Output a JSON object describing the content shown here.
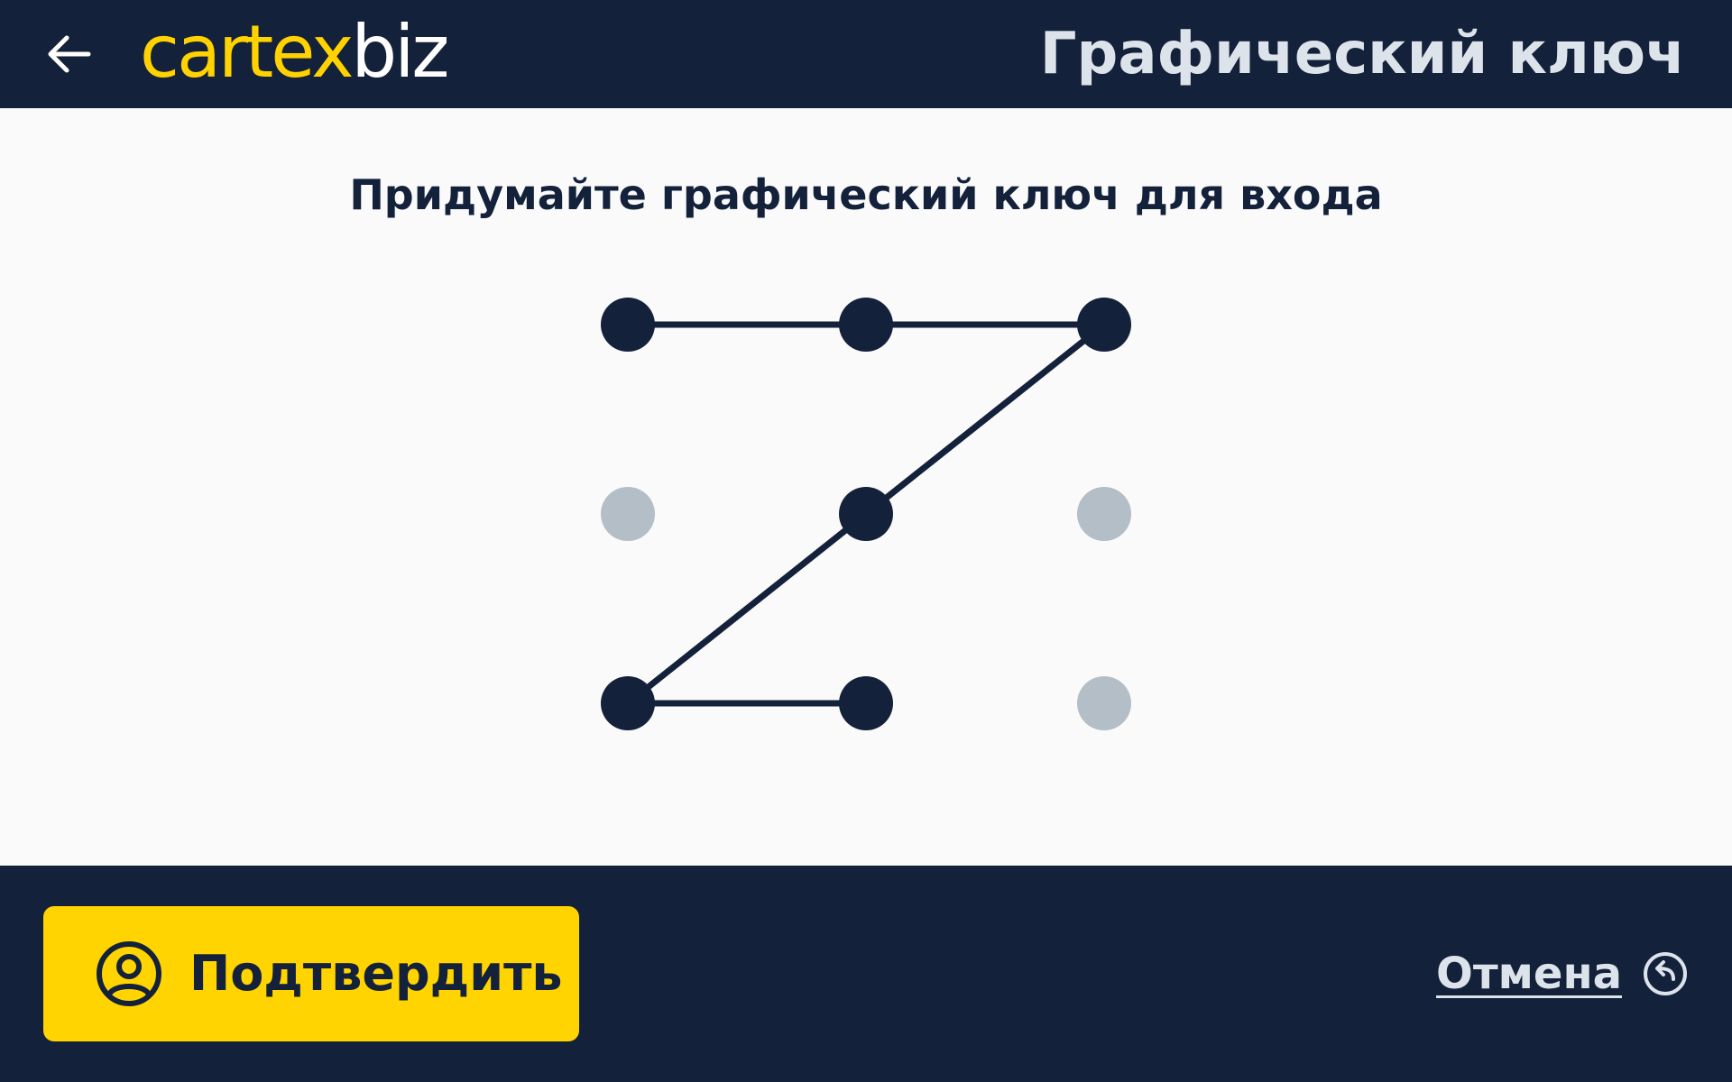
{
  "header": {
    "back_icon": "arrow-left-icon",
    "logo_part1": "cartex",
    "logo_part2": "biz",
    "title": "Графический ключ"
  },
  "main": {
    "prompt": "Придумайте графический ключ для входа",
    "pattern": {
      "grid_rows": 3,
      "grid_cols": 3,
      "selected_sequence": [
        1,
        2,
        3,
        5,
        7,
        8
      ],
      "active_color": "#14213a",
      "inactive_color": "#b3bec6",
      "line_color": "#14213a"
    }
  },
  "footer": {
    "confirm_label": "Подтвердить",
    "confirm_icon": "user-circle-icon",
    "cancel_label": "Отмена",
    "cancel_icon": "undo-circle-icon"
  },
  "colors": {
    "navy": "#14213a",
    "yellow": "#ffd400",
    "light_text": "#dde3ea",
    "background": "#fafafa"
  }
}
